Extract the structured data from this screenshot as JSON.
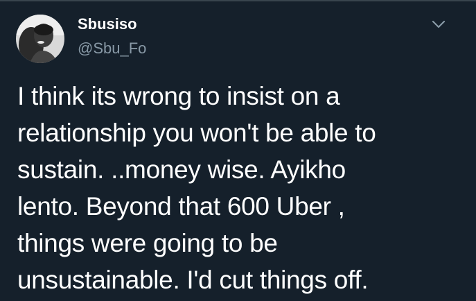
{
  "tweet": {
    "author": {
      "display_name": "Sbusiso",
      "handle": "@Sbu_Fo",
      "avatar_icon": "user-avatar-photo"
    },
    "menu_icon": "chevron-down-icon",
    "text_lines": [
      "I think its wrong to insist on a",
      "relationship you won't be able to",
      "sustain. ..money wise. Ayikho",
      "lento. Beyond that 600 Uber ,",
      "things were going to be",
      "unsustainable. I'd cut things off."
    ]
  },
  "theme": {
    "background": "#15202b",
    "text": "#ffffff",
    "secondary_text": "#8899a6",
    "divider": "#38444d"
  }
}
